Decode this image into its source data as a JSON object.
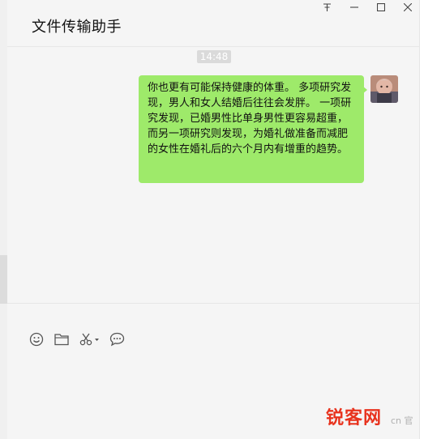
{
  "window": {
    "title": "文件传输助手",
    "controls": {
      "pin": "pin-icon",
      "minimize": "minimize-icon",
      "maximize": "maximize-icon",
      "close": "close-icon"
    }
  },
  "chat": {
    "timestamp": "14:48",
    "message": "你也更有可能保持健康的体重。 多项研究发现，男人和女人结婚后往往会发胖。 一项研究发现，已婚男性比单身男性更容易超重，而另一项研究则发现，为婚礼做准备而减肥的女性在婚礼后的六个月内有增重的趋势。",
    "bubble_color": "#9eea6a"
  },
  "toolbar": {
    "icons": [
      "emoji-icon",
      "folder-icon",
      "scissors-icon",
      "chat-history-icon"
    ]
  },
  "watermark": {
    "brand": "锐客网",
    "sub": "cn 官"
  }
}
